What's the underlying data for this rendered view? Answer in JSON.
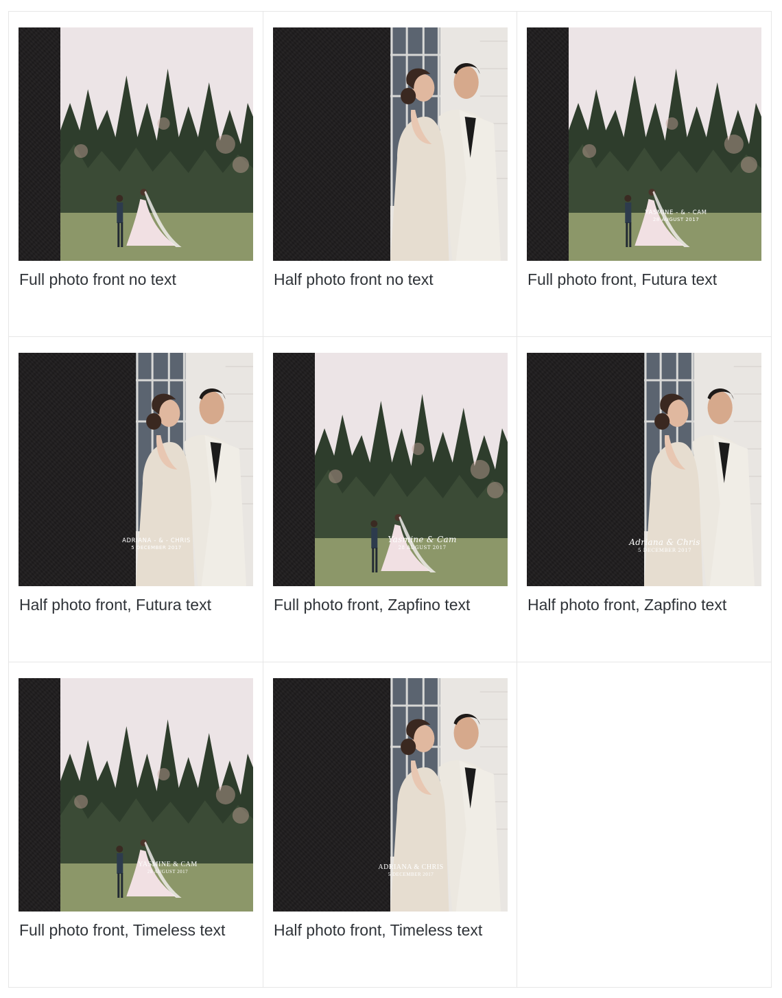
{
  "options": [
    {
      "caption": "Full photo front no text",
      "layout": "full",
      "scene": "trees",
      "font": "",
      "cover_names": "",
      "cover_date": ""
    },
    {
      "caption": "Half photo front no text",
      "layout": "half",
      "scene": "couple",
      "font": "",
      "cover_names": "",
      "cover_date": ""
    },
    {
      "caption": "Full photo front, Futura text",
      "layout": "full",
      "scene": "trees",
      "font": "futura",
      "cover_names": "YASMINE - & - CAM",
      "cover_date": "28 AUGUST 2017"
    },
    {
      "caption": "Half photo front, Futura text",
      "layout": "half",
      "scene": "couple",
      "font": "futura",
      "cover_names": "ADRIANA - & - CHRIS",
      "cover_date": "5 DECEMBER 2017"
    },
    {
      "caption": "Full photo front, Zapfino text",
      "layout": "full",
      "scene": "trees",
      "font": "zapfino",
      "cover_names": "Yasmine & Cam",
      "cover_date": "28 AUGUST 2017"
    },
    {
      "caption": "Half photo front, Zapfino text",
      "layout": "half",
      "scene": "couple",
      "font": "zapfino",
      "cover_names": "Adriana & Chris",
      "cover_date": "5 DECEMBER 2017"
    },
    {
      "caption": "Full photo front, Timeless text",
      "layout": "full",
      "scene": "trees",
      "font": "timeless",
      "cover_names": "YASMINE & CAM",
      "cover_date": "28 AUGUST 2017"
    },
    {
      "caption": "Half photo front, Timeless text",
      "layout": "half",
      "scene": "couple",
      "font": "timeless",
      "cover_names": "ADRIANA & CHRIS",
      "cover_date": "5 DECEMBER 2017"
    }
  ],
  "colors": {
    "spine": "#1e1c1d",
    "caption_text": "#2f3338",
    "grid_border": "#e6e6e6"
  }
}
